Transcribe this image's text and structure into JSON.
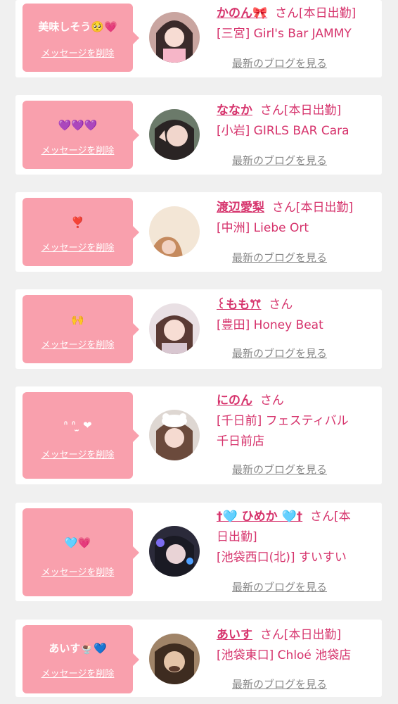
{
  "delete_label": "メッセージを削除",
  "blog_label": "最新のブログを見る",
  "cards": [
    {
      "message": "美味しそう🥺💗",
      "name": "かのん🎀",
      "suffix": "さん[本日出勤]",
      "shop": "[三宮] Girl's Bar JAMMY",
      "line2": ""
    },
    {
      "message": "💜💜💜",
      "name": "ななか",
      "suffix": "さん[本日出勤]",
      "shop": "[小岩] GIRLS BAR Cara",
      "line2": ""
    },
    {
      "message": "❣️",
      "name": "渡辺愛梨",
      "suffix": "さん[本日出勤]",
      "shop": "[中洲] Liebe Ort",
      "line2": ""
    },
    {
      "message": "🙌",
      "name": "꒰ももꔫ",
      "suffix": "さん",
      "shop": "[豊田] Honey Beat",
      "line2": ""
    },
    {
      "message": "ᐢ ᐢ ̫ ❤",
      "name": "にのん",
      "suffix": "さん",
      "shop": "[千日前] フェスティバル",
      "line2": "千日前店"
    },
    {
      "message": "🩵💗",
      "name": "†🩵 ひめか 🩵†",
      "suffix": "さん[本",
      "suffix2": "日出勤]",
      "shop": "[池袋西口(北)] すいすい",
      "line2": ""
    },
    {
      "message": "あいす🍨💙",
      "name": "あいす",
      "suffix": "さん[本日出勤]",
      "shop": "[池袋東口] Chloé 池袋店",
      "line2": ""
    }
  ],
  "colors": {
    "bubble": "#f9a0ad",
    "accent": "#d6336c",
    "link_gray": "#888888",
    "background": "#f0f0f0"
  }
}
